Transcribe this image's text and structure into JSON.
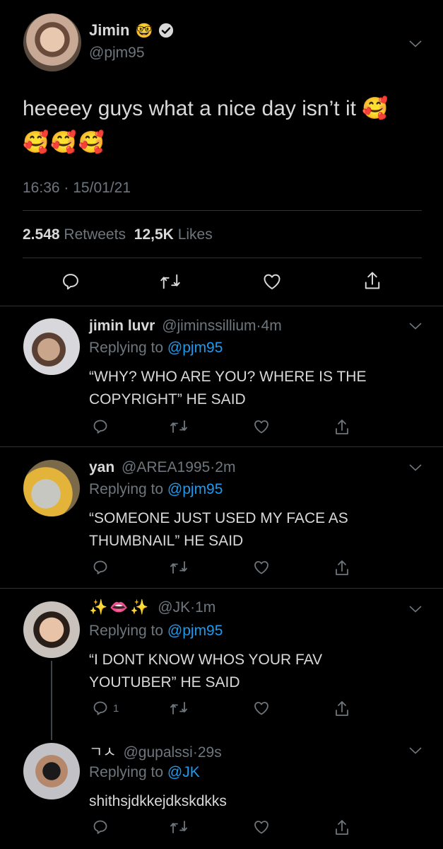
{
  "colors": {
    "background": "#000000",
    "text": "#d9d9d9",
    "secondary": "#6e767d",
    "link": "#1d9bf0",
    "divider": "#2f3336"
  },
  "main_tweet": {
    "name": "Jimin",
    "name_emoji": "🤓",
    "handle": "@pjm95",
    "text_line1": "heeeey guys what a nice day isn’t it 🥰",
    "text_line2": "🥰🥰🥰",
    "time": "16:36",
    "sep": "·",
    "date": "15/01/21",
    "retweets_count": "2.548",
    "retweets_label": "Retweets",
    "likes_count": "12,5K",
    "likes_label": "Likes"
  },
  "replies": [
    {
      "name": "jimin luvr",
      "handle": "@jiminssillium",
      "sep": "·",
      "time": "4m",
      "replying_label": "Replying to",
      "replying_to": "@pjm95",
      "line1": "“WHY? WHO ARE YOU? WHERE IS THE",
      "line2": "COPYRIGHT” HE SAID",
      "reply_count": ""
    },
    {
      "name": "yan",
      "handle": "@AREA1995",
      "sep": "·",
      "time": "2m",
      "replying_label": "Replying to",
      "replying_to": "@pjm95",
      "line1": "“SOMEONE JUST USED MY FACE AS",
      "line2": "THUMBNAIL” HE SAID",
      "reply_count": ""
    },
    {
      "name": "✨👄✨",
      "handle": "@JK",
      "sep": "·",
      "time": "1m",
      "replying_label": "Replying to",
      "replying_to": "@pjm95",
      "line1": "“I DONT KNOW WHOS YOUR FAV",
      "line2": "YOUTUBER” HE SAID",
      "reply_count": "1"
    },
    {
      "name": "ㄱㅅ",
      "handle": "@gupalssi",
      "sep": "·",
      "time": "29s",
      "replying_label": "Replying to",
      "replying_to": "@JK",
      "line1": "shithsjdkkejdkskdkks",
      "line2": "",
      "reply_count": ""
    }
  ]
}
